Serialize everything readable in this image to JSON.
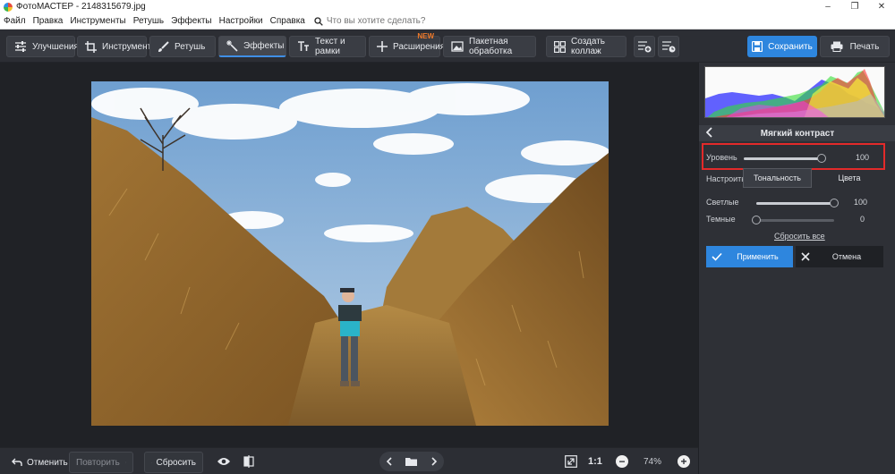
{
  "window": {
    "title": "ФотоМАСТЕР - 2148315679.jpg",
    "minimize": "–",
    "maximize": "❐",
    "close": "✕"
  },
  "menu": {
    "items": [
      "Файл",
      "Правка",
      "Инструменты",
      "Ретушь",
      "Эффекты",
      "Настройки",
      "Справка"
    ],
    "search_placeholder": "Что вы хотите сделать?"
  },
  "toolbar": {
    "tabs": [
      {
        "label": "Улучшения",
        "icon": "sliders-icon"
      },
      {
        "label": "Инструменты",
        "icon": "crop-icon"
      },
      {
        "label": "Ретушь",
        "icon": "brush-icon"
      },
      {
        "label": "Эффекты",
        "icon": "magic-wand-icon",
        "active": true
      },
      {
        "label": "Текст и рамки",
        "icon": "text-icon"
      },
      {
        "label": "Расширения",
        "icon": "plus-icon",
        "badge": "NEW"
      },
      {
        "label": "Пакетная обработка",
        "icon": "batch-image-icon"
      },
      {
        "label": "Создать коллаж",
        "icon": "collage-icon"
      }
    ],
    "save_label": "Сохранить",
    "print_label": "Печать",
    "accent_color": "#2e86de"
  },
  "bottom": {
    "undo_label": "Отменить",
    "redo_label": "Повторить",
    "reset_label": "Сбросить",
    "ratio_label": "1:1",
    "zoom": "74%"
  },
  "panel": {
    "title": "Мягкий контраст",
    "level_label": "Уровень",
    "level_value": "100",
    "level_fraction": 1.0,
    "adjust_label": "Настроить",
    "tabs": [
      {
        "label": "Тональность",
        "active": true
      },
      {
        "label": "Цвета",
        "active": false
      }
    ],
    "highlights_label": "Светлые",
    "highlights_value": "100",
    "highlights_fraction": 1.0,
    "shadows_label": "Темные",
    "shadows_value": "0",
    "shadows_fraction": 0.0,
    "reset_all_label": "Сбросить все",
    "apply_label": "Применить",
    "cancel_label": "Отмена"
  }
}
